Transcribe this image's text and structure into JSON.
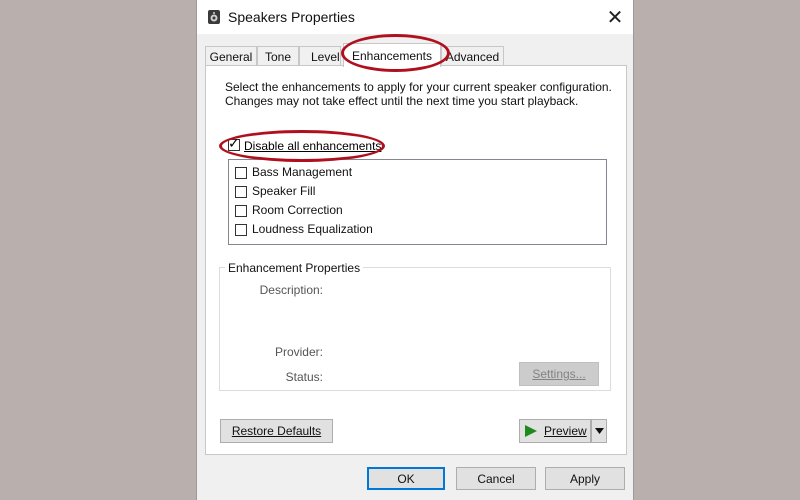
{
  "window": {
    "title": "Speakers Properties",
    "close_glyph": "✕"
  },
  "tabs": [
    {
      "label": "General"
    },
    {
      "label": "Tone"
    },
    {
      "label": "Level"
    },
    {
      "label": "Enhancements",
      "active": true
    },
    {
      "label": "Advanced"
    }
  ],
  "enhancements": {
    "description": "Select the enhancements to apply for your current speaker configuration. Changes may not take effect until the next time you start playback.",
    "disable_all": {
      "label": "Disable all enhancements",
      "checked": true
    },
    "items": [
      {
        "label": "Bass Management",
        "checked": false
      },
      {
        "label": "Speaker Fill",
        "checked": false
      },
      {
        "label": "Room Correction",
        "checked": false
      },
      {
        "label": "Loudness Equalization",
        "checked": false
      }
    ],
    "properties": {
      "title": "Enhancement Properties",
      "description_label": "Description:",
      "provider_label": "Provider:",
      "status_label": "Status:",
      "settings_button": "Settings..."
    },
    "restore_defaults": "Restore Defaults",
    "preview": "Preview"
  },
  "footer": {
    "ok": "OK",
    "cancel": "Cancel",
    "apply": "Apply"
  },
  "colors": {
    "highlight_ring": "#b0101e",
    "play_icon": "#1e8a1e",
    "focus_border": "#0078d7"
  },
  "icons": {
    "title": "speaker-icon",
    "close": "close-icon",
    "play": "play-icon",
    "dropdown": "dropdown-arrow-icon"
  }
}
